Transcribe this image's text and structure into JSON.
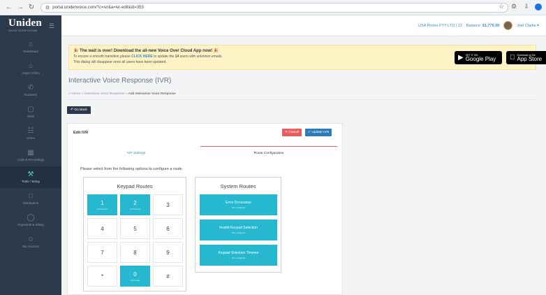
{
  "browser": {
    "url": "portal.unidenvoice.com/?c=ivr&a=ivr-edit&id=353"
  },
  "header": {
    "logo": "Uniden",
    "logo_sub": "VOICE OVER CLOUD",
    "account": "USA Phone PTY LTD | 12",
    "balance_label": "Balance:",
    "balance_value": "$1,779.00",
    "user": "Joel Clarke"
  },
  "sidebar": {
    "items": [
      {
        "label": "Dashboard",
        "icon": "home-icon"
      },
      {
        "label": "Super Admin",
        "icon": "home-icon"
      },
      {
        "label": "Numbers",
        "icon": "phone-icon"
      },
      {
        "label": "SMS",
        "icon": "message-icon"
      },
      {
        "label": "Users",
        "icon": "users-icon"
      },
      {
        "label": "Calls & Recordings",
        "icon": "calendar-icon"
      },
      {
        "label": "Tools / Setup",
        "icon": "tools-icon"
      },
      {
        "label": "Distribution",
        "icon": "document-icon"
      },
      {
        "label": "Payments & Billing",
        "icon": "shield-icon"
      },
      {
        "label": "My Account",
        "icon": "user-icon"
      }
    ]
  },
  "banner": {
    "title": "The wait is over! Download the all-new Voice Over Cloud App now!",
    "line1_pre": "To ensure a smooth transition please ",
    "line1_link": "CLICK HERE",
    "line1_mid": " to update the ",
    "line1_count": "14",
    "line1_post": " users with unknown emails.",
    "line2": "This dialog will disappear once all users have been updated.",
    "google_small": "GET IT ON",
    "google_big": "Google Play",
    "apple_small": "Download on the",
    "apple_big": "App Store"
  },
  "page": {
    "title": "Interactive Voice Response (IVR)",
    "breadcrumb": [
      "Home",
      "Interactive Voice Response",
      "Add Interactive Voice Response"
    ],
    "back_label": "Go Back"
  },
  "card": {
    "title": "Edit IVR",
    "cancel_label": "Cancel",
    "update_label": "Update IVR",
    "tabs": [
      "IVR Settings",
      "Route Configuration"
    ],
    "hint": "Please select from the following options to configure a route."
  },
  "keypad": {
    "title": "Keypad Routes",
    "keys": [
      {
        "label": "1",
        "sub": "Conference",
        "active": true
      },
      {
        "label": "2",
        "sub": "Conference",
        "active": true
      },
      {
        "label": "3",
        "sub": "",
        "active": false
      },
      {
        "label": "4",
        "sub": "",
        "active": false
      },
      {
        "label": "5",
        "sub": "",
        "active": false
      },
      {
        "label": "6",
        "sub": "",
        "active": false
      },
      {
        "label": "7",
        "sub": "",
        "active": false
      },
      {
        "label": "8",
        "sub": "",
        "active": false
      },
      {
        "label": "9",
        "sub": "",
        "active": false
      },
      {
        "label": "*",
        "sub": "",
        "active": false
      },
      {
        "label": "0",
        "sub": "Voicemail",
        "active": true
      },
      {
        "label": "#",
        "sub": "",
        "active": false
      }
    ]
  },
  "system_routes": {
    "title": "System Routes",
    "items": [
      {
        "label": "Error Occurance",
        "sub": "Not configured"
      },
      {
        "label": "Invalid Keypad Selection",
        "sub": "Not configured"
      },
      {
        "label": "Keypad Selection Timeout",
        "sub": "Not configured"
      }
    ]
  },
  "colors": {
    "sidebar": "#2d3a4b",
    "accent_teal": "#26b8cf",
    "cancel_red": "#e85d5d",
    "update_blue": "#2b7bb9",
    "banner_yellow": "#fdf3c4"
  }
}
